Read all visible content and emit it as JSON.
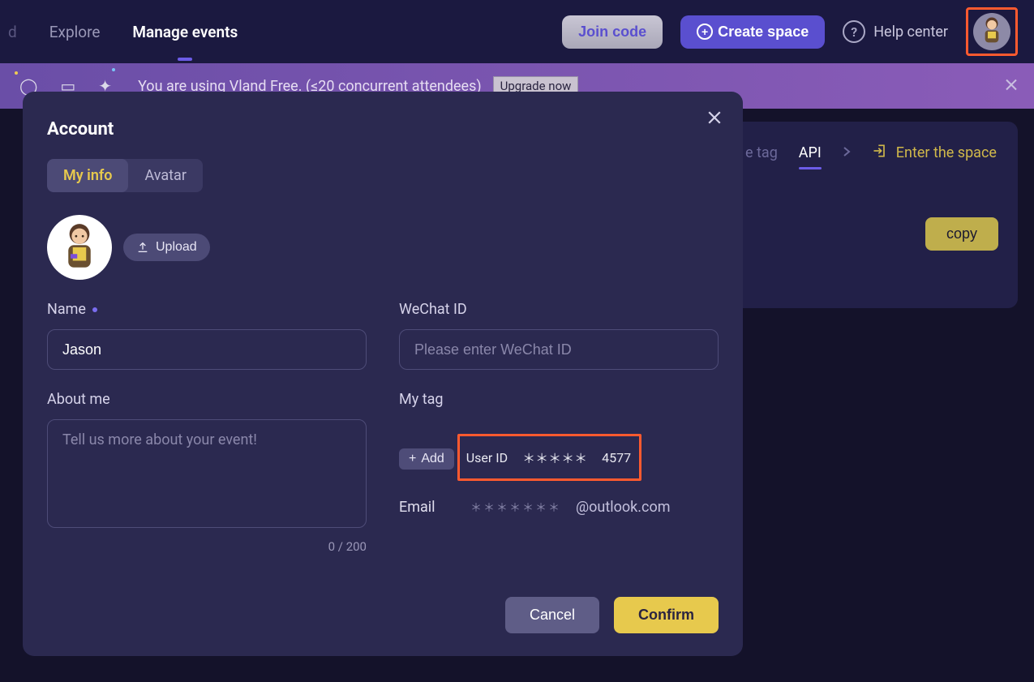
{
  "nav": {
    "trunc": "d",
    "explore": "Explore",
    "manage": "Manage events"
  },
  "header": {
    "join": "Join code",
    "create": "Create space",
    "help": "Help center"
  },
  "banner": {
    "text": "You are using Vland Free. (≤20 concurrent attendees)",
    "upgrade": "Upgrade now"
  },
  "rightpane": {
    "tag": "e tag",
    "api": "API",
    "enter": "Enter the space",
    "copy": "copy"
  },
  "modal": {
    "title": "Account",
    "tabs": {
      "info": "My info",
      "avatar": "Avatar"
    },
    "upload": "Upload",
    "name": {
      "label": "Name",
      "value": "Jason"
    },
    "about": {
      "label": "About me",
      "placeholder": "Tell us more about your event!",
      "counter": "0 / 200"
    },
    "wechat": {
      "label": "WeChat ID",
      "placeholder": "Please enter WeChat ID"
    },
    "mytag": {
      "label": "My tag",
      "add": "Add"
    },
    "userid": {
      "label": "User ID",
      "masked": "＊＊＊＊＊",
      "value": "4577"
    },
    "email": {
      "label": "Email",
      "masked": "＊＊＊＊＊＊＊",
      "value": "@outlook.com"
    },
    "cancel": "Cancel",
    "confirm": "Confirm"
  }
}
